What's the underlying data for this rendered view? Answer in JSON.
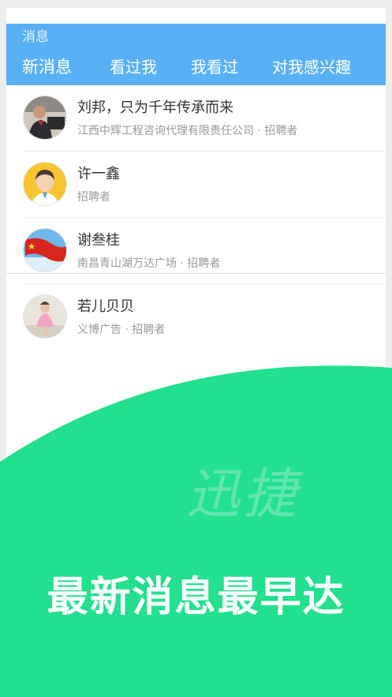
{
  "header": {
    "title": "消息"
  },
  "tabs": [
    {
      "label": "新消息"
    },
    {
      "label": "看过我"
    },
    {
      "label": "我看过"
    },
    {
      "label": "对我感兴趣"
    }
  ],
  "messages": [
    {
      "name": "刘邦，只为千年传承而来",
      "subtitle": "江西中辉工程咨询代理有限责任公司 · 招聘者",
      "avatar_icon": "person-photo-avatar"
    },
    {
      "name": "许一鑫",
      "subtitle": "招聘者",
      "avatar_icon": "cartoon-man-avatar"
    },
    {
      "name": "谢叁桂",
      "subtitle": "南昌青山湖万达广场 · 招聘者",
      "avatar_icon": "red-flag-avatar"
    },
    {
      "name": "若儿贝贝",
      "subtitle": "义博广告 · 招聘者",
      "avatar_icon": "child-photo-avatar"
    }
  ],
  "promo": {
    "watermark": "迅捷",
    "slogan": "最新消息最早达",
    "background_color": "#23e08e"
  },
  "colors": {
    "header": "#5ab0f5",
    "accent_green": "#23e08e"
  }
}
